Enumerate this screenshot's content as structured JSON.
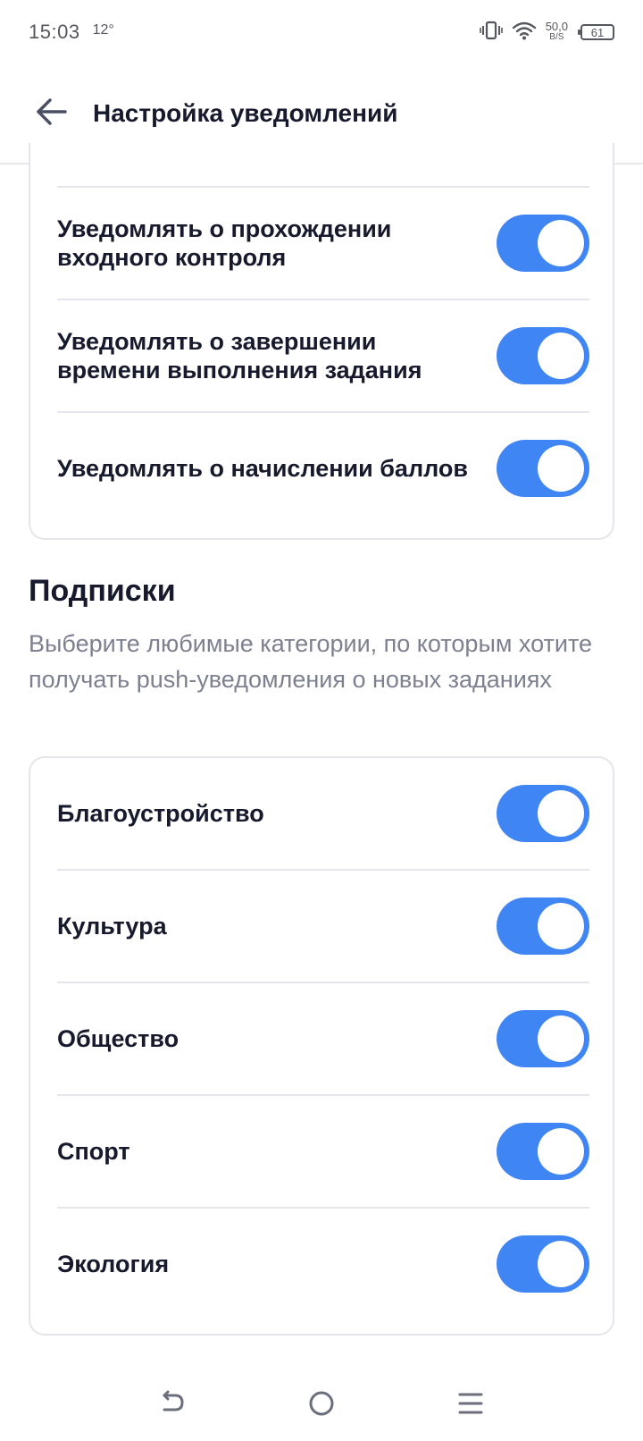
{
  "status_bar": {
    "time": "15:03",
    "temperature": "12°",
    "net_speed_value": "50,0",
    "net_speed_unit": "B/S",
    "battery": "61"
  },
  "header": {
    "title": "Настройка уведомлений",
    "back_icon": "arrow-left-icon"
  },
  "notifications": {
    "items": [
      {
        "label": "Уведомлять о прохождении входного контроля",
        "enabled": true
      },
      {
        "label": "Уведомлять о завершении времени выполнения задания",
        "enabled": true
      },
      {
        "label": "Уведомлять о начислении баллов",
        "enabled": true
      }
    ]
  },
  "subscriptions": {
    "title": "Подписки",
    "description": "Выберите любимые категории, по которым хотите получать push-уведомления о новых заданиях",
    "items": [
      {
        "label": "Благоустройство",
        "enabled": true
      },
      {
        "label": "Культура",
        "enabled": true
      },
      {
        "label": "Общество",
        "enabled": true
      },
      {
        "label": "Спорт",
        "enabled": true
      },
      {
        "label": "Экология",
        "enabled": true
      }
    ]
  },
  "colors": {
    "toggle_on": "#3f86f4",
    "text_primary": "#161a2c",
    "text_secondary": "#7d8090"
  },
  "nav_bar": {
    "back_icon": "nav-back-icon",
    "home_icon": "nav-home-icon",
    "menu_icon": "nav-menu-icon"
  }
}
